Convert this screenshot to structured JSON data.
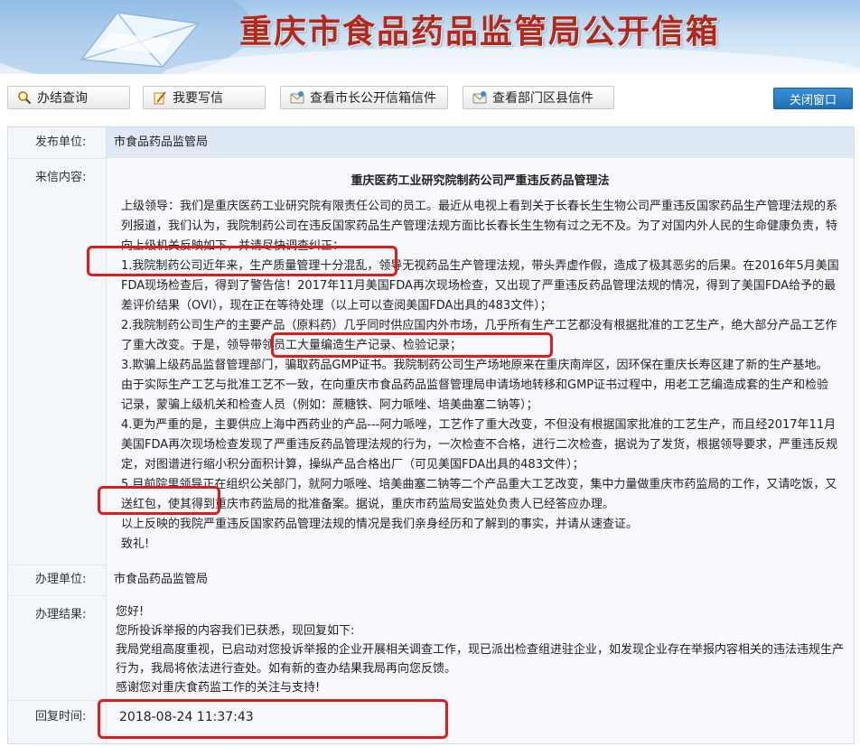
{
  "header": {
    "title": "重庆市食品药品监管局公开信箱"
  },
  "toolbar": {
    "buttons": [
      {
        "label": "办结查询",
        "icon": "search-icon"
      },
      {
        "label": "我要写信",
        "icon": "pencil-icon"
      },
      {
        "label": "查看市长公开信箱信件",
        "icon": "mail-icon"
      },
      {
        "label": "查看部门区县信件",
        "icon": "mail-icon"
      }
    ],
    "close_label": "关闭窗口"
  },
  "record": {
    "publisher_label": "发布单位:",
    "publisher": "市食品药品监管局",
    "content_label": "来信内容:",
    "letter_title": "重庆医药工业研究院制药公司严重违反药品管理法",
    "paragraphs": [
      "上级领导：我们是重庆医药工业研究院有限责任公司的员工。最近从电视上看到关于长春长生生物公司严重违反国家药品生产管理法规的系列报道，我们认为，我院制药公司在违反国家药品生产管理法规方面比长春长生生物有过之无不及。为了对国内外人民的生命健康负责，特向上级机关反映如下，并请尽快调查纠正：",
      "1.我院制药公司近年来，生产质量管理十分混乱，领导无视药品生产管理法规，带头弄虚作假，造成了极其恶劣的后果。在2016年5月美国FDA现场检查后，得到了警告信！2017年11月美国FDA再次现场检查，又出现了严重违反药品管理法规的情况，得到了美国FDA给予的最差评价结果（OVI），现在正在等待处理（以上可以查阅美国FDA出具的483文件）；",
      "2.我院制药公司生产的主要产品（原料药）几乎同时供应国内外市场，几乎所有生产工艺都没有根据批准的工艺生产，绝大部分产品工艺作了重大改变。于是，领导带领员工大量编造生产记录、检验记录；",
      "3.欺骗上级药品监督管理部门，骗取药品GMP证书。我院制药公司生产场地原来在重庆南岸区，因环保在重庆长寿区建了新的生产基地。由于实际生产工艺与批准工艺不一致，在向重庆市食品药品监督管理局申请场地转移和GMP证书过程中，用老工艺编造成套的生产和检验记录，蒙骗上级机关和检查人员（例如：蔗糖铁、阿力哌唑、培美曲塞二钠等）；",
      "4.更为严重的是，主要供应上海中西药业的产品---阿力哌唑，工艺作了重大改变，不但没有根据国家批准的工艺生产，而且经2017年11月美国FDA再次现场检查发现了严重违反药品管理法规的行为，一次检查不合格，进行二次检查，据说为了发货，根据领导要求，严重违反规定，对图谱进行缩小积分面积计算，操纵产品合格出厂（可见美国FDA出具的483文件）；",
      "5.目前院里领导正在组织公关部门，就阿力哌唑、培美曲塞二钠等二个产品重大工艺改变，集中力量做重庆市药监局的工作，又请吃饭，又送红包，使其得到重庆市药监局的批准备案。据说，重庆市药监局安监处负责人已经答应办理。",
      "以上反映的我院严重违反国家药品管理法规的情况是我们亲身经历和了解到的事实，并请从速查证。",
      "致礼!"
    ],
    "handler_label": "办理单位:",
    "handler": "市食品药品监管局",
    "result_label": "办理结果:",
    "result_lines": [
      "您好!",
      "您所投诉举报的内容我们已获悉，现回复如下:",
      "我局党组高度重视，已启动对您投诉举报的企业开展相关调查工作，现已派出检查组进驻企业，如发现企业存在举报内容相关的违法违规生产行为，我局将依法进行查处。如有新的查办结果我局再向您反馈。",
      "感谢您对重庆食药监工作的关注与支持!"
    ],
    "reply_time_label": "回复时间:",
    "reply_time": "2018-08-24 11:37:43"
  },
  "colors": {
    "title_red": "#b4281c",
    "highlight_red": "#e01b1b",
    "accent_blue": "#1f6fb6"
  }
}
